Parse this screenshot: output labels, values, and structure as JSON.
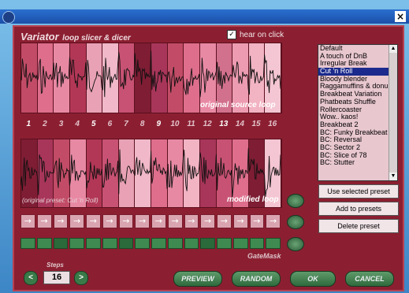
{
  "window": {
    "close_label": "×"
  },
  "app": {
    "title": "Variator",
    "subtitle": "loop slicer & dicer",
    "hear_on_click_label": "hear on click",
    "hear_on_click_checked": true
  },
  "loops": {
    "source_label": "original source loop",
    "modified_label": "modified loop",
    "modified_preset_note": "(original preset: Cut 'n Roll)",
    "source_shades": [
      "#c24c67",
      "#de6e8c",
      "#e889a4",
      "#b23756",
      "#e9a2b5",
      "#f0b8c8",
      "#c85273",
      "#7e1d34",
      "#a8365a",
      "#c24c67",
      "#de6e8c",
      "#e889a4",
      "#d2718d",
      "#ec9bb0",
      "#f2b3c3",
      "#f4c5d2"
    ],
    "modified_shades": [
      "#7e1d34",
      "#a8365a",
      "#c24c67",
      "#e889a4",
      "#b23756",
      "#c85273",
      "#e9a2b5",
      "#f0b8c8",
      "#de6e8c",
      "#e889a4",
      "#f2b3c3",
      "#a8365a",
      "#c85273",
      "#de6e8c",
      "#7e1d34",
      "#f4c5d2"
    ]
  },
  "slice_numbers": [
    "1",
    "2",
    "3",
    "4",
    "5",
    "6",
    "7",
    "8",
    "9",
    "10",
    "11",
    "12",
    "13",
    "14",
    "15",
    "16"
  ],
  "highlight_numbers": [
    1,
    5,
    9,
    13
  ],
  "arrow_rows": {
    "symbol": "→",
    "count": 16
  },
  "gates": [
    1,
    1,
    0,
    1,
    1,
    1,
    0,
    1,
    1,
    1,
    1,
    0,
    1,
    1,
    1,
    1
  ],
  "gatemask_label": "GateMask",
  "presets": [
    "Default",
    "A touch of DnB",
    "Irregular Break",
    "Cut 'n Roll",
    "Bloody blender",
    "Raggamuffins & donu",
    "Breakbeat Variation",
    "Phatbeats Shuffle",
    "Rollercoaster",
    "Wow.. kaos!",
    "Breakbeat 2",
    "BC: Funky Breakbeat",
    "BC: Reversal",
    "BC: Sector 2",
    "BC: Slice of 78",
    "BC: Stutter"
  ],
  "selected_preset": "Cut 'n Roll",
  "buttons": {
    "use_selected": "Use selected preset",
    "add_to_presets": "Add to presets",
    "delete_preset": "Delete preset",
    "preview": "PREVIEW",
    "random": "RANDOM",
    "ok": "OK",
    "cancel": "CANCEL"
  },
  "steps": {
    "label": "Steps",
    "value": "16",
    "dec": "<",
    "inc": ">"
  },
  "colors": {
    "panel": "#8b1f31",
    "gate_on": "#3f8a50",
    "selected": "#1b2a8c"
  }
}
